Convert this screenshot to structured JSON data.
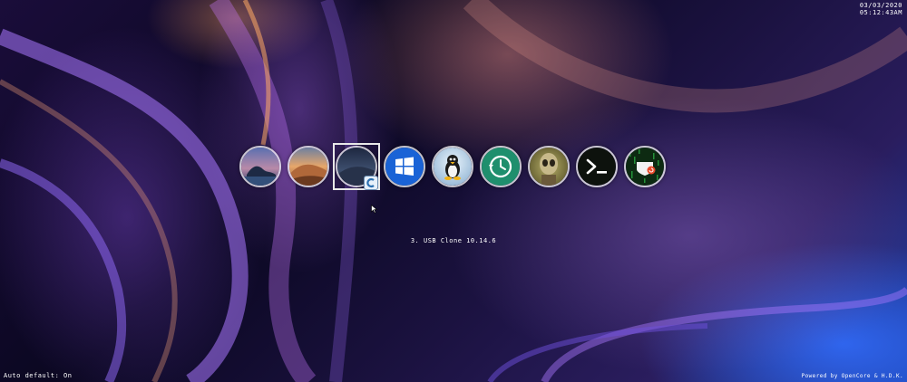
{
  "clock": {
    "date": "03/03/2020",
    "time": "05:12:43AM"
  },
  "picker": {
    "selected_index": 2,
    "selected_label": "3. USB Clone 10.14.6",
    "entries": [
      {
        "icon": "macos-catalina-icon"
      },
      {
        "icon": "macos-mojave-icon"
      },
      {
        "icon": "macos-mojave-dark-icon",
        "badge": "carbon-copy-cloner-badge-icon"
      },
      {
        "icon": "windows-icon"
      },
      {
        "icon": "linux-tux-icon"
      },
      {
        "icon": "time-machine-icon"
      },
      {
        "icon": "alien-icon"
      },
      {
        "icon": "terminal-shell-icon"
      },
      {
        "icon": "reset-nvram-icon"
      }
    ]
  },
  "footer": {
    "auto_default": "Auto default: On",
    "powered_by": "Powered by OpenCore & H.D.K."
  },
  "colors": {
    "windows_blue": "#1a63d6",
    "time_machine_green": "#1f8f6d",
    "terminal_bg": "#0d120d",
    "selector_border": "#e8e8e8"
  }
}
